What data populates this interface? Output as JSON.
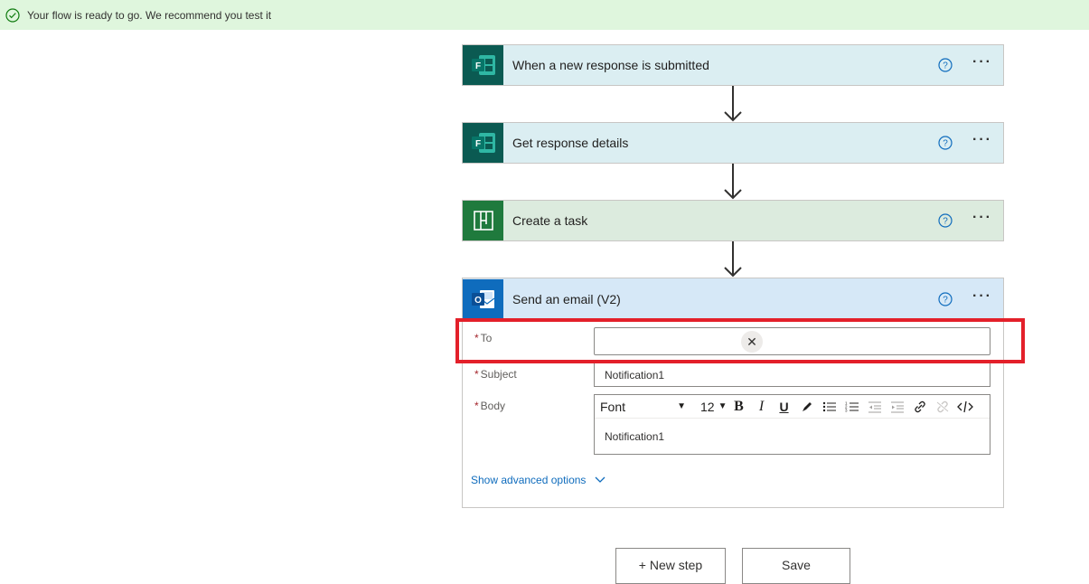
{
  "banner": {
    "message": "Your flow is ready to go. We recommend you test it",
    "icon": "check-circle-icon"
  },
  "steps": [
    {
      "title": "When a new response is submitted",
      "icon": "forms-icon"
    },
    {
      "title": "Get response details",
      "icon": "forms-icon"
    },
    {
      "title": "Create a task",
      "icon": "planner-icon"
    },
    {
      "title": "Send an email (V2)",
      "icon": "outlook-icon"
    }
  ],
  "email": {
    "to_label": "To",
    "to_value": "",
    "subject_label": "Subject",
    "subject_value": "Notification1",
    "body_label": "Body",
    "required_marker": "*",
    "font_label": "Font",
    "font_size": "12",
    "bold": "B",
    "italic": "I",
    "underline": "U",
    "body_value": "Notification1",
    "advanced_label": "Show advanced options",
    "clear_glyph": "✕"
  },
  "more_glyph": "···",
  "actions": {
    "new_step": "+ New step",
    "save": "Save"
  },
  "colors": {
    "banner_bg": "#dff6dd",
    "highlight": "#e3202a",
    "link": "#0f6cbd"
  }
}
